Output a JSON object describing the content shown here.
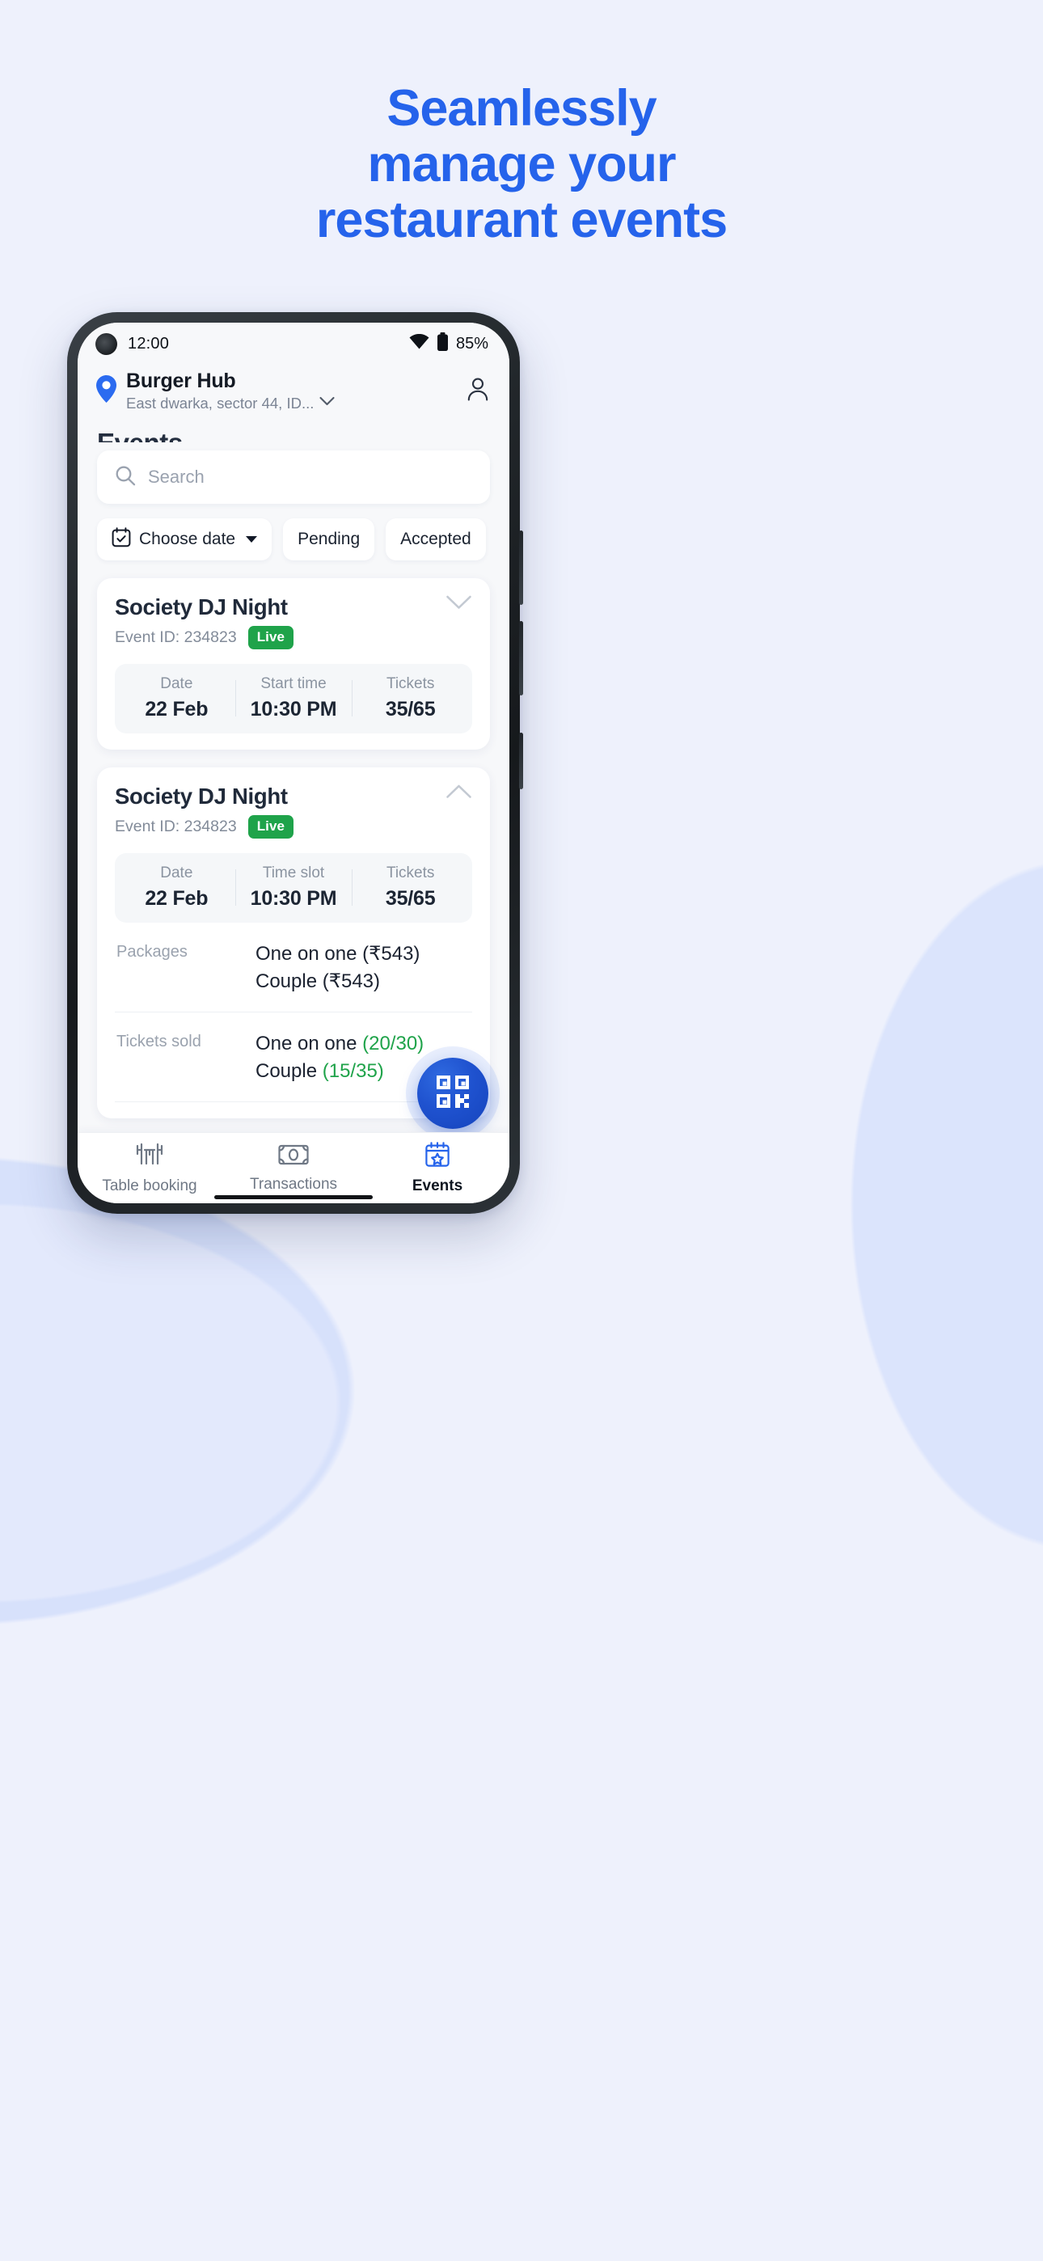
{
  "hero": {
    "lines": [
      "Seamlessly",
      "manage your",
      "restaurant events"
    ],
    "color": "#2563eb"
  },
  "phone": {
    "status_bar": {
      "time": "12:00",
      "wifi_icon": "wifi-icon",
      "battery_icon": "battery-icon",
      "battery_percent": "85%"
    },
    "header": {
      "location_pin_icon": "location-pin-icon",
      "business_name": "Burger Hub",
      "address": "East dwarka, sector 44, ID...",
      "address_chevron_icon": "chevron-down-icon",
      "profile_icon": "person-icon"
    },
    "screen_title": "Events",
    "search": {
      "icon": "search-icon",
      "placeholder": "Search",
      "value": ""
    },
    "filters": [
      {
        "label": "Choose date",
        "icon": "calendar-check-icon",
        "has_caret": true
      },
      {
        "label": "Pending",
        "icon": "",
        "has_caret": false
      },
      {
        "label": "Accepted",
        "icon": "",
        "has_caret": false
      }
    ],
    "events": [
      {
        "title": "Society DJ Night",
        "id_label": "Event ID: 234823",
        "badge": "Live",
        "badge_color": "#1fa34a",
        "expanded": false,
        "toggle_icon": "chevron-down-icon",
        "stats": [
          {
            "key": "Date",
            "value": "22 Feb"
          },
          {
            "key": "Start time",
            "value": "10:30 PM"
          },
          {
            "key": "Tickets",
            "value": "35/65"
          }
        ]
      },
      {
        "title": "Society DJ Night",
        "id_label": "Event ID: 234823",
        "badge": "Live",
        "badge_color": "#1fa34a",
        "expanded": true,
        "toggle_icon": "chevron-up-icon",
        "stats": [
          {
            "key": "Date",
            "value": "22 Feb"
          },
          {
            "key": "Time slot",
            "value": "10:30 PM"
          },
          {
            "key": "Tickets",
            "value": "35/65"
          }
        ],
        "details": [
          {
            "key": "Packages",
            "lines": [
              {
                "name": "One on one (₹543)",
                "count": ""
              },
              {
                "name": "Couple (₹543)",
                "count": ""
              }
            ]
          },
          {
            "key": "Tickets sold",
            "lines": [
              {
                "name": "One on one ",
                "count": "(20/30)"
              },
              {
                "name": "Couple ",
                "count": "(15/35)"
              }
            ]
          }
        ]
      }
    ],
    "fab": {
      "icon": "qr-code-icon",
      "color": "#1f52cf"
    },
    "bottom_nav": [
      {
        "label": "Table booking",
        "icon": "table-chairs-icon",
        "active": false
      },
      {
        "label": "Transactions",
        "icon": "banknote-icon",
        "active": false
      },
      {
        "label": "Events",
        "icon": "calendar-star-icon",
        "active": true
      }
    ]
  }
}
